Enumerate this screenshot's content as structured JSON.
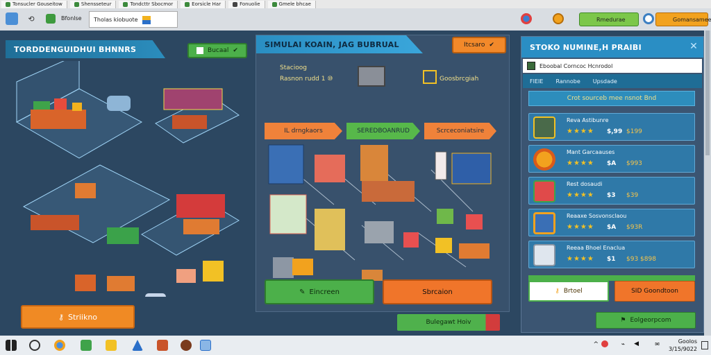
{
  "tabs": [
    {
      "label": "Tonsucler Gouseitow"
    },
    {
      "label": "Shensseteur"
    },
    {
      "label": "Tondcttr Sbocmor"
    },
    {
      "label": "Eorsicle Har"
    },
    {
      "label": "Fonuolie"
    },
    {
      "label": "Gmele bhcae"
    }
  ],
  "toolbar": {
    "address": "Tholas kiobuote",
    "shortcut": "Bfonlse",
    "currency_button": "Rmedurae",
    "profile_button": "Gomansamee"
  },
  "left_panel": {
    "title": "TORDDENGUIDHUI BHNNRS",
    "top_button": "Bucaal",
    "start_button": "Striikno"
  },
  "mid_panel": {
    "title": "SIMULAI KOAIN, JAG BUBRUAL",
    "top_button": "Itcsaro",
    "stat1": "Stacioog",
    "stat2": "Rasnon rudd 1 ⑩",
    "stat3": "Goosbrcgiah",
    "chips": [
      "IL drngkaors",
      "SEREDBOANRUD",
      "Scrceconiatsire"
    ],
    "action_green": "Eincreen",
    "action_orange": "Sbrcaion",
    "footer_button": "Bulegawt Hoiv"
  },
  "right_panel": {
    "title": "STOKO NUMINE,H PRAIBI",
    "search": "Eboobal Corncoc Hcnrodol",
    "tabs": [
      "FIEIE",
      "Rannobe",
      "Upsdade"
    ],
    "banner": "Crot sourceb mee nsnot Bnd",
    "items": [
      {
        "name": "Reva Astibunre",
        "stars": "★★★★",
        "price": "$,99",
        "extra": "$199"
      },
      {
        "name": "Mant Garcaauses",
        "stars": "★★★★",
        "price": "$A",
        "extra": "$993"
      },
      {
        "name": "Rest dosaudi",
        "stars": "★★★★",
        "price": "$3",
        "extra": "$39"
      },
      {
        "name": "Reaaxe Sosvonsclaou",
        "stars": "★★★★",
        "price": "$A",
        "extra": "$93R"
      },
      {
        "name": "Reeaa Bhoel Enaclua",
        "stars": "★★★★",
        "price": "$1",
        "extra": "$93 $898"
      }
    ],
    "action_white": "Brtoel",
    "action_orange": "SID Goondtoon",
    "footer_button": "Eolgeorpcom"
  },
  "taskbar": {
    "time": "Goolos",
    "date": "3/15/9022"
  }
}
